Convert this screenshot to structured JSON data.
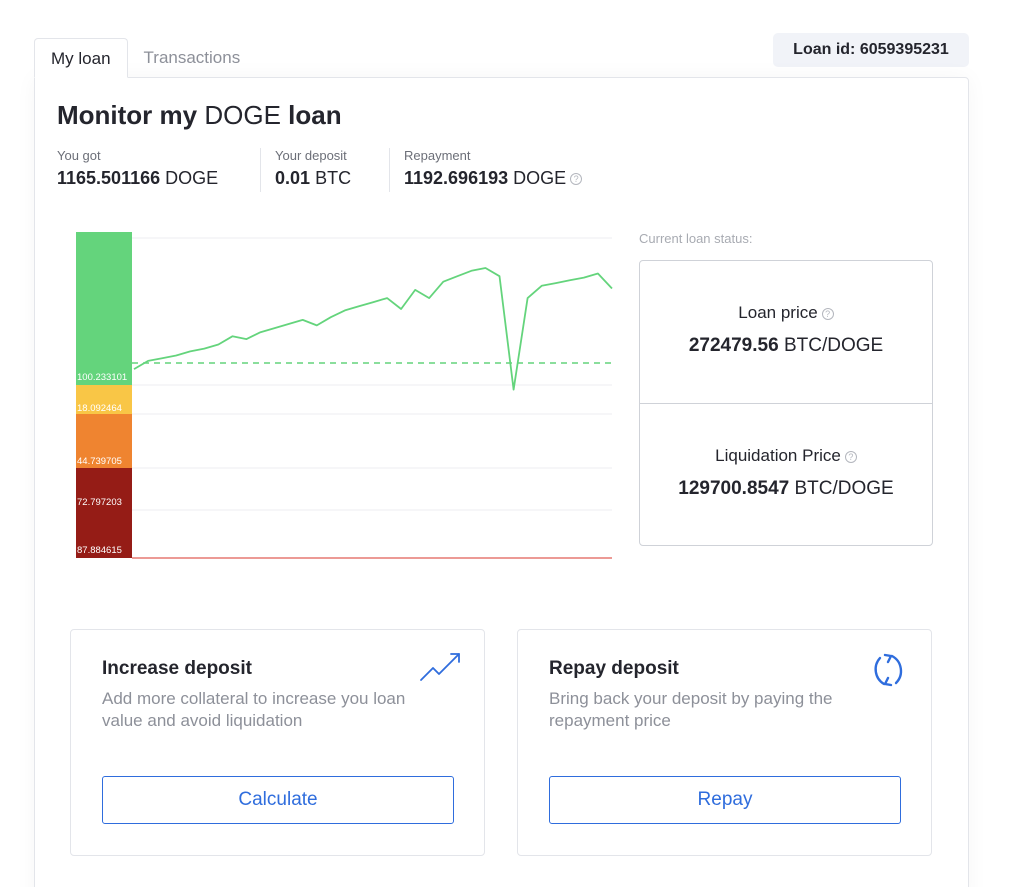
{
  "tabs": [
    {
      "label": "My loan",
      "active": true
    },
    {
      "label": "Transactions",
      "active": false
    }
  ],
  "loan_id": "Loan id: 6059395231",
  "header": {
    "title_prefix": "Monitor my",
    "title_currency": "DOGE",
    "title_suffix": "loan"
  },
  "stats": [
    {
      "label": "You got",
      "amount": "1165.501166",
      "unit": "DOGE"
    },
    {
      "label": "Your deposit",
      "amount": "0.01",
      "unit": "BTC"
    },
    {
      "label": "Repayment",
      "amount": "1192.696193",
      "unit": "DOGE"
    }
  ],
  "status": {
    "heading": "Current loan status:",
    "loan_price": {
      "label": "Loan price",
      "amount": "272479.56",
      "unit": "BTC/DOGE"
    },
    "liquidation_price": {
      "label": "Liquidation Price",
      "amount": "129700.8547",
      "unit": "BTC/DOGE"
    }
  },
  "actions": [
    {
      "title": "Increase deposit",
      "description": "Add more collateral to increase you loan value and avoid liquidation",
      "button": "Calculate",
      "icon": "trending-up-icon"
    },
    {
      "title": "Repay deposit",
      "description": "Bring back your deposit by paying the repayment price",
      "button": "Repay",
      "icon": "refresh-icon"
    }
  ],
  "colors": {
    "accent": "#2f6ddd",
    "zone_safe": "#64d47c",
    "zone_caution": "#f9c646",
    "zone_warning": "#ef8430",
    "zone_danger": "#951c16",
    "price_line": "#64d47c",
    "liquidation_line": "#d9342b"
  },
  "chart_data": {
    "type": "line",
    "zones": [
      {
        "level": "safe",
        "label": "100.233101"
      },
      {
        "level": "caution",
        "label": "18.092464"
      },
      {
        "level": "warning",
        "label": "44.739705"
      },
      {
        "level": "danger",
        "label": "72.797203"
      },
      {
        "level": "danger",
        "label": "87.884615"
      }
    ],
    "reference_line": {
      "style": "dashed",
      "value": 272479.56
    },
    "liquidation_line": {
      "value": 129700.8547
    },
    "series": [
      {
        "values": [
          268000,
          274000,
          276000,
          278000,
          281000,
          283000,
          286000,
          292000,
          290000,
          295000,
          298000,
          301000,
          304000,
          300000,
          306000,
          311000,
          314000,
          317000,
          320000,
          312000,
          326000,
          320000,
          332000,
          336000,
          340000,
          342000,
          336000,
          253000,
          320000,
          329000,
          331000,
          333000,
          335000,
          338000,
          327000
        ]
      }
    ]
  }
}
